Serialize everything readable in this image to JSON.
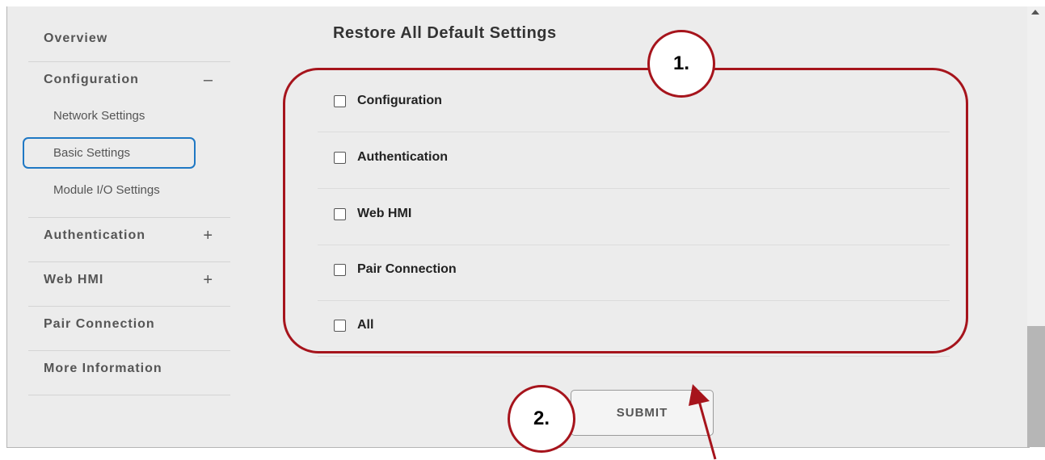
{
  "sidebar": {
    "overview": "Overview",
    "configuration": {
      "label": "Configuration",
      "toggle": "–"
    },
    "config_items": [
      "Network Settings",
      "Basic Settings",
      "Module I/O Settings"
    ],
    "authentication": {
      "label": "Authentication",
      "toggle": "+"
    },
    "web_hmi": {
      "label": "Web HMI",
      "toggle": "+"
    },
    "pair_connection": "Pair Connection",
    "more_information": "More Information"
  },
  "main": {
    "title": "Restore All Default Settings",
    "options": [
      "Configuration",
      "Authentication",
      "Web HMI",
      "Pair Connection",
      "All"
    ],
    "submit_label": "SUBMIT"
  },
  "annotations": {
    "callout_1": "1.",
    "callout_2": "2.",
    "highlight_color": "#a6141c",
    "active_color": "#1f78c4"
  }
}
